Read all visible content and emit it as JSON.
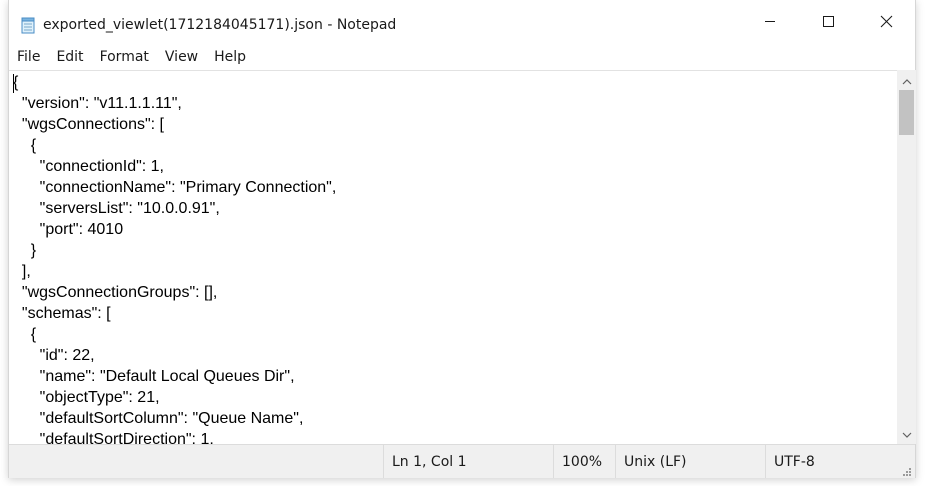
{
  "window": {
    "title": "exported_viewlet(1712184045171).json - Notepad"
  },
  "menu": {
    "items": [
      {
        "label": "File"
      },
      {
        "label": "Edit"
      },
      {
        "label": "Format"
      },
      {
        "label": "View"
      },
      {
        "label": "Help"
      }
    ]
  },
  "editor": {
    "lines": [
      "{",
      "  \"version\": \"v11.1.1.11\",",
      "  \"wgsConnections\": [",
      "    {",
      "      \"connectionId\": 1,",
      "      \"connectionName\": \"Primary Connection\",",
      "      \"serversList\": \"10.0.0.91\",",
      "      \"port\": 4010",
      "    }",
      "  ],",
      "  \"wgsConnectionGroups\": [],",
      "  \"schemas\": [",
      "    {",
      "      \"id\": 22,",
      "      \"name\": \"Default Local Queues Dir\",",
      "      \"objectType\": 21,",
      "      \"defaultSortColumn\": \"Queue Name\",",
      "      \"defaultSortDirection\": 1,"
    ]
  },
  "status": {
    "position": "Ln 1, Col 1",
    "zoom": "100%",
    "line_ending": "Unix (LF)",
    "encoding": "UTF-8"
  },
  "icons": {
    "app": "notepad-icon",
    "minimize": "minimize-icon",
    "maximize": "maximize-icon",
    "close": "close-icon"
  }
}
